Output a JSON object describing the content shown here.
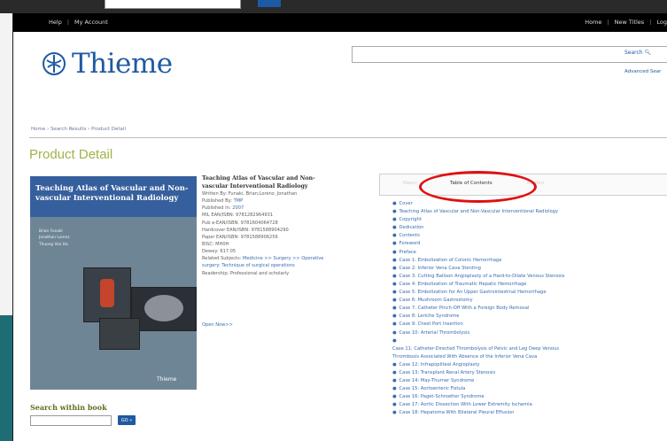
{
  "top_nav": {
    "left": [
      "Help",
      "My Account"
    ],
    "right": [
      "Home",
      "New Titles",
      "Log"
    ]
  },
  "brand": {
    "name": "Thieme",
    "color": "#1e5aa0"
  },
  "search": {
    "label": "Search",
    "advanced": "Advanced Sear"
  },
  "breadcrumb": "Home › Search Results › Product Detail",
  "page_title": "Product Detail",
  "cover": {
    "title": "Teaching Atlas of Vascular and Non-vascular Interventional Radiology",
    "authors": [
      "Brian Funaki",
      "Jonathan Lorenz",
      "Thuong Van Ha"
    ],
    "publisher": "Thieme"
  },
  "book": {
    "title": "Teaching Atlas of Vascular and Non-vascular Interventional Radiology",
    "written_by": "Written By: Funaki, Brian;Lorenz, Jonathan",
    "published_by_label": "Published By:",
    "published_by": "TMP",
    "published_in_label": "Published In:",
    "published_in": "2007",
    "mil_ean": "MIL EAN/ISBN: 9781282964931",
    "pub_ean": "Pub e-EAN/ISBN: 9781604064728",
    "hardcover": "Hardcover EAN/ISBN: 9781588904290",
    "paper": "Paper EAN/ISBN: 9781588906256",
    "bisac": "BISC: MH0H",
    "dewey": "Dewey: 617.05",
    "related_label": "Related Subjects:",
    "related": "Medicine >> Surgery >> Operative surgery: Technique of surgical operations",
    "readership": "Readership: Professional and scholarly",
    "open_now": "Open Now>>"
  },
  "search_within": {
    "title": "Search within book",
    "button": "GO »"
  },
  "tabs": {
    "left": "Descr",
    "active": "Table of Contents",
    "right": "Edition"
  },
  "toc": [
    "Cover",
    "Teaching Atlas of Vascular and Non-Vascular Interventional Radiology",
    "Copyright",
    "Dedication",
    "Contents",
    "Foreword",
    "Preface",
    "Case 1: Embolization of Colonic Hemorrhage",
    "Case 2: Inferior Vena Cava Stenting",
    "Case 3: Cutting Balloon Angioplasty of a Hard-to-Dilate Venous Stenosis",
    "Case 4: Embolization of Traumatic Hepatic Hemorrhage",
    "Case 5: Embolization for An Upper Gastrointestinal Hemorrhage",
    "Case 6: Mushroom Gastrostomy",
    "Case 7: Catheter Pinch-Off With a Foreign Body Removal",
    "Case 8: Leriche Syndrome",
    "Case 9: Chest Port Insertion",
    "Case 10: Arterial Thrombolysis",
    "",
    "Case 11: Catheter-Directed Thrombolysis of Pelvic and Leg Deep Venous",
    "Thrombosis Associated With Absence of the Inferior Vena Cava",
    "Case 12: Infrapopliteal Angioplasty",
    "Case 13: Transplant Renal Artery Stenosis",
    "Case 14: May-Thurner Syndrome",
    "Case 15: Aortoenteric Fistula",
    "Case 16: Paget-Schroetter Syndrome",
    "Case 17: Aortic Dissection With Lower Extremity Ischemia",
    "Case 18: Hepatoma With Bilateral Pleural Effusion"
  ]
}
